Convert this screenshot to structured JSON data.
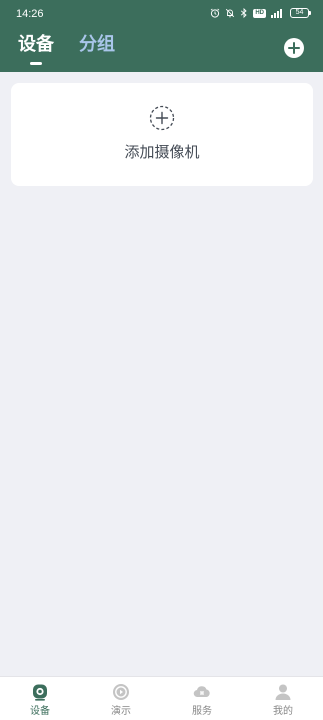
{
  "status_bar": {
    "time": "14:26",
    "battery": "54",
    "icons": [
      "alarm-icon",
      "mute-icon",
      "bluetooth-icon",
      "hd-icon",
      "signal-icon"
    ],
    "hd_label": "HD"
  },
  "header": {
    "tabs": [
      {
        "label": "设备",
        "active": true
      },
      {
        "label": "分组",
        "active": false
      }
    ],
    "add_icon": "plus-circle-icon",
    "colors": {
      "background": "#3c6e5c",
      "active_tab": "#ffffff",
      "inactive_tab": "#a9c6ea"
    }
  },
  "card": {
    "label": "添加摄像机",
    "icon": "dashed-plus-circle-icon"
  },
  "bottom_nav": {
    "items": [
      {
        "label": "设备",
        "icon": "camera-icon",
        "active": true
      },
      {
        "label": "演示",
        "icon": "play-circle-icon",
        "active": false
      },
      {
        "label": "服务",
        "icon": "cloud-icon",
        "active": false
      },
      {
        "label": "我的",
        "icon": "user-icon",
        "active": false
      }
    ],
    "colors": {
      "active": "#3c6e5c",
      "inactive": "#b5b5b5"
    }
  }
}
